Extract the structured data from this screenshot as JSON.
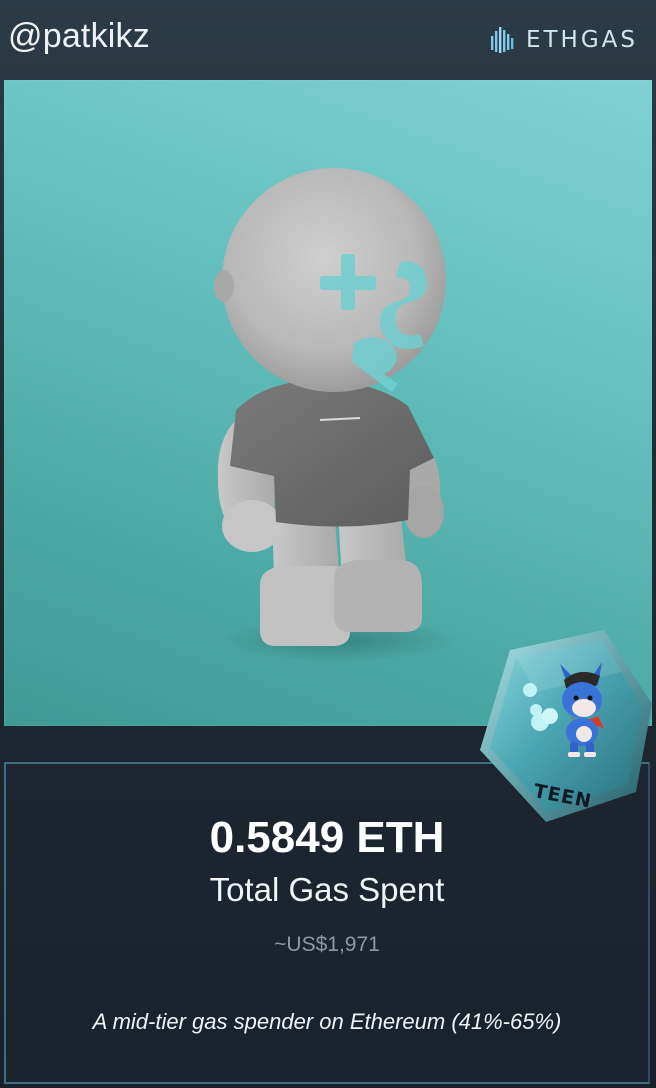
{
  "header": {
    "handle": "@patkikz",
    "brand_name": "ETHGAS",
    "brand_icon": "ethgas-bars-logo-icon"
  },
  "nft": {
    "icon": "nft-character-figure",
    "colors": {
      "background": "#6cc6c4",
      "figure": "#bdbdbd",
      "shirt": "#6f6f6f",
      "head_marks": "#6fcfd1"
    }
  },
  "badge": {
    "label": "TEEN",
    "icon": "donkey-mascot-icon",
    "colors": {
      "fill": "#58b9c2",
      "edge": "#2f7d89"
    }
  },
  "stats": {
    "amount": "0.5849 ETH",
    "label": "Total Gas Spent",
    "fiat": "~US$1,971",
    "tier_description": "A mid-tier gas spender on Ethereum (41%-65%)"
  },
  "colors": {
    "page_bg": "#1f2a33",
    "card_border": "#3e6f86",
    "muted_text": "#8e98a3"
  }
}
